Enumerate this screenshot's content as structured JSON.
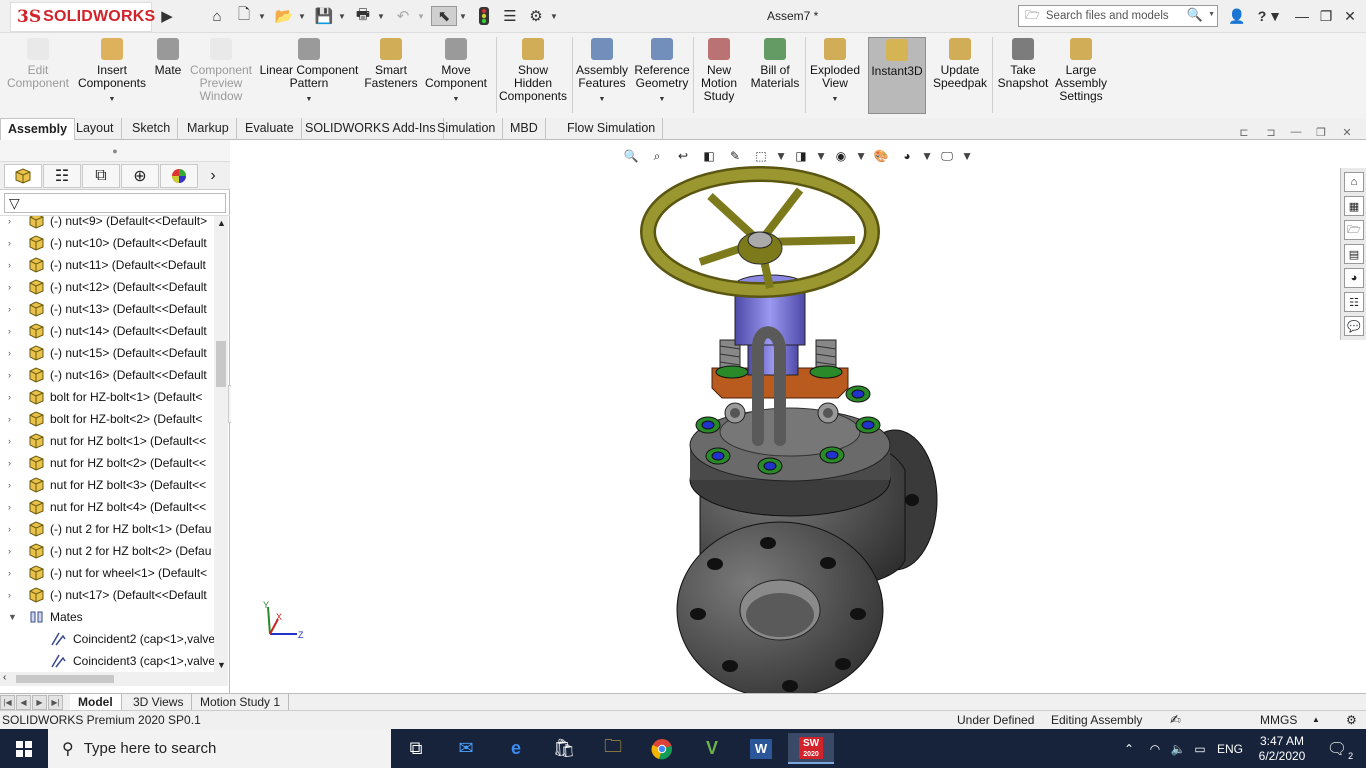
{
  "app": {
    "logo_ds": "3S",
    "logo_text": "SOLIDWORKS",
    "document_title": "Assem7 *",
    "search_placeholder": "Search files and models",
    "help_label": "?"
  },
  "ribbon": [
    {
      "label": "Edit\nComponent",
      "icon": "edit-component-icon",
      "disabled": true
    },
    {
      "label": "Insert\nComponents",
      "icon": "insert-components-icon",
      "dropdown": true
    },
    {
      "label": "Mate",
      "icon": "mate-icon"
    },
    {
      "label": "Component\nPreview\nWindow",
      "icon": "preview-window-icon",
      "disabled": true
    },
    {
      "label": "Linear Component\nPattern",
      "icon": "linear-pattern-icon",
      "dropdown": true
    },
    {
      "label": "Smart\nFasteners",
      "icon": "smart-fasteners-icon"
    },
    {
      "label": "Move\nComponent",
      "icon": "move-component-icon",
      "dropdown": true
    },
    {
      "label": "Show\nHidden\nComponents",
      "icon": "show-hidden-icon"
    },
    {
      "label": "Assembly\nFeatures",
      "icon": "assembly-features-icon",
      "dropdown": true
    },
    {
      "label": "Reference\nGeometry",
      "icon": "reference-geometry-icon",
      "dropdown": true
    },
    {
      "label": "New\nMotion\nStudy",
      "icon": "motion-study-icon"
    },
    {
      "label": "Bill of\nMaterials",
      "icon": "bom-icon"
    },
    {
      "label": "Exploded\nView",
      "icon": "exploded-view-icon",
      "dropdown": true
    },
    {
      "label": "Instant3D",
      "icon": "instant3d-icon",
      "active": true
    },
    {
      "label": "Update\nSpeedpak",
      "icon": "speedpak-icon"
    },
    {
      "label": "Take\nSnapshot",
      "icon": "snapshot-icon"
    },
    {
      "label": "Large\nAssembly\nSettings",
      "icon": "large-assembly-icon"
    }
  ],
  "tabs": [
    "Assembly",
    "Layout",
    "Sketch",
    "Markup",
    "Evaluate",
    "SOLIDWORKS Add-Ins",
    "Simulation",
    "MBD",
    "Flow Simulation"
  ],
  "tree": [
    {
      "text": "(-) nut<9> (Default<<Default>",
      "type": "part"
    },
    {
      "text": "(-) nut<10> (Default<<Default",
      "type": "part"
    },
    {
      "text": "(-) nut<11> (Default<<Default",
      "type": "part"
    },
    {
      "text": "(-) nut<12> (Default<<Default",
      "type": "part"
    },
    {
      "text": "(-) nut<13> (Default<<Default",
      "type": "part"
    },
    {
      "text": "(-) nut<14> (Default<<Default",
      "type": "part"
    },
    {
      "text": "(-) nut<15> (Default<<Default",
      "type": "part"
    },
    {
      "text": "(-) nut<16> (Default<<Default",
      "type": "part"
    },
    {
      "text": "bolt for HZ-bolt<1> (Default<",
      "type": "part"
    },
    {
      "text": "bolt for HZ-bolt<2> (Default<",
      "type": "part"
    },
    {
      "text": "nut for HZ bolt<1> (Default<<",
      "type": "part"
    },
    {
      "text": "nut for HZ bolt<2> (Default<<",
      "type": "part"
    },
    {
      "text": "nut for HZ bolt<3> (Default<<",
      "type": "part"
    },
    {
      "text": "nut for HZ bolt<4> (Default<<",
      "type": "part"
    },
    {
      "text": "(-) nut 2 for HZ bolt<1> (Defau",
      "type": "part"
    },
    {
      "text": "(-) nut 2 for HZ bolt<2> (Defau",
      "type": "part"
    },
    {
      "text": "(-) nut for wheel<1> (Default<",
      "type": "part"
    },
    {
      "text": "(-) nut<17> (Default<<Default",
      "type": "part"
    },
    {
      "text": "Mates",
      "type": "mates"
    },
    {
      "text": "Coincident2 (cap<1>,valve",
      "type": "mate"
    },
    {
      "text": "Coincident3 (cap<1>,valve",
      "type": "mate"
    }
  ],
  "bottom_tabs": [
    "Model",
    "3D Views",
    "Motion Study 1"
  ],
  "status": {
    "version": "SOLIDWORKS Premium 2020 SP0.1",
    "state": "Under Defined",
    "mode": "Editing Assembly",
    "units": "MMGS"
  },
  "triad": {
    "x": "X",
    "y": "Y",
    "z": "Z"
  },
  "taskbar": {
    "search_placeholder": "Type here to search",
    "apps": [
      "task-view",
      "mail",
      "edge",
      "store",
      "file-explorer",
      "chrome",
      "vectorworks",
      "word",
      "solidworks"
    ],
    "solidworks_badge": "2020",
    "lang": "ENG",
    "time": "3:47 AM",
    "date": "6/2/2020",
    "notifications": "2"
  },
  "colors": {
    "brand_red": "#d2232a",
    "wheel": "#7d7a1c",
    "valve_body": "#4a4a4a",
    "yoke": "#b95a1f",
    "bonnet": "#6e6be0",
    "nut_green": "#2a8a2a",
    "nut_blue": "#2233cc"
  }
}
